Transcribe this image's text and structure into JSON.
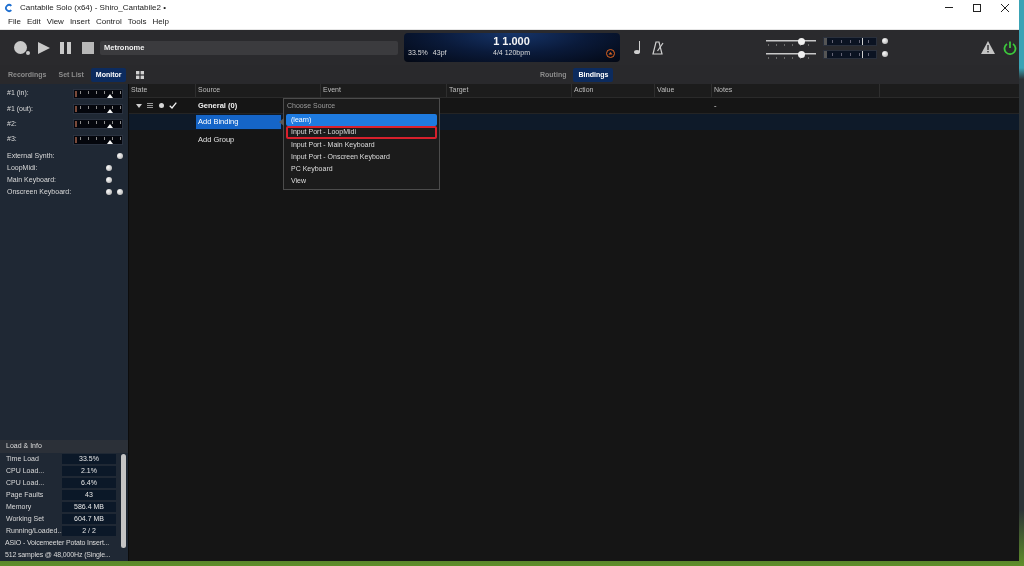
{
  "window": {
    "title": "Cantabile Solo (x64) - Shiro_Cantabile2 •"
  },
  "menu": [
    "File",
    "Edit",
    "View",
    "Insert",
    "Control",
    "Tools",
    "Help"
  ],
  "toolbar": {
    "song": "Metronome",
    "transport": {
      "position": "1 1.000",
      "load": "33.5%",
      "latency": "43pf",
      "tempo": "4/4 120bpm"
    },
    "sliders": [
      {
        "level": 0.75
      },
      {
        "level": 0.75
      }
    ]
  },
  "side_tabs": [
    {
      "label": "Recordings",
      "selected": false
    },
    {
      "label": "Set List",
      "selected": false
    },
    {
      "label": "Monitor",
      "selected": true
    }
  ],
  "view_tabs": [
    {
      "label": "Routing",
      "selected": false
    },
    {
      "label": "Bindings",
      "selected": true
    }
  ],
  "monitor": {
    "channels": [
      {
        "name": "#1 (in):",
        "level": 0.76
      },
      {
        "name": "#1 (out):",
        "level": 0.76
      },
      {
        "name": "#2:",
        "level": 0.76
      },
      {
        "name": "#3:",
        "level": 0.76
      }
    ],
    "ports": [
      {
        "name": "External Synth:",
        "dot_1": false,
        "dot_2": true
      },
      {
        "name": "LoopMidi:",
        "dot_1": true,
        "dot_2": false
      },
      {
        "name": "Main Keyboard:",
        "dot_1": true,
        "dot_2": false
      },
      {
        "name": "Onscreen Keyboard:",
        "dot_1": true,
        "dot_2": true
      }
    ]
  },
  "load_info": {
    "title": "Load & Info",
    "rows": [
      {
        "label": "Time Load",
        "value": "33.5%"
      },
      {
        "label": "CPU Load...",
        "value": "2.1%"
      },
      {
        "label": "CPU Load...",
        "value": "6.4%"
      },
      {
        "label": "Page Faults",
        "value": "43"
      },
      {
        "label": "Memory",
        "value": "586.4 MB"
      },
      {
        "label": "Working Set",
        "value": "604.7 MB"
      },
      {
        "label": "Running/Loaded...",
        "value": "2 / 2"
      }
    ],
    "lines": [
      "ASIO - Voicemeeter Potato Insert...",
      "512 samples @ 48,000Hz (Single..."
    ]
  },
  "bindings": {
    "columns": [
      "State",
      "Source",
      "Event",
      "Target",
      "Action",
      "Value",
      "Notes"
    ],
    "rows": [
      {
        "kind": "group",
        "source": "General (0)",
        "notes": "-",
        "expanded": true,
        "checked": true,
        "selected": false
      },
      {
        "kind": "action",
        "source": "Add Binding",
        "selected": true
      },
      {
        "kind": "action",
        "source": "Add Group",
        "selected": false
      }
    ]
  },
  "source_menu": {
    "header": "Choose Source",
    "items": [
      {
        "label": "(learn)",
        "selected": true,
        "outlined": false
      },
      {
        "label": "Input Port - LoopMidi",
        "selected": false,
        "outlined": true
      },
      {
        "label": "Input Port - Main Keyboard",
        "selected": false,
        "outlined": false
      },
      {
        "label": "Input Port - Onscreen Keyboard",
        "selected": false,
        "outlined": false
      },
      {
        "label": "PC Keyboard",
        "selected": false,
        "outlined": false
      },
      {
        "label": "View",
        "selected": false,
        "outlined": false
      }
    ]
  }
}
